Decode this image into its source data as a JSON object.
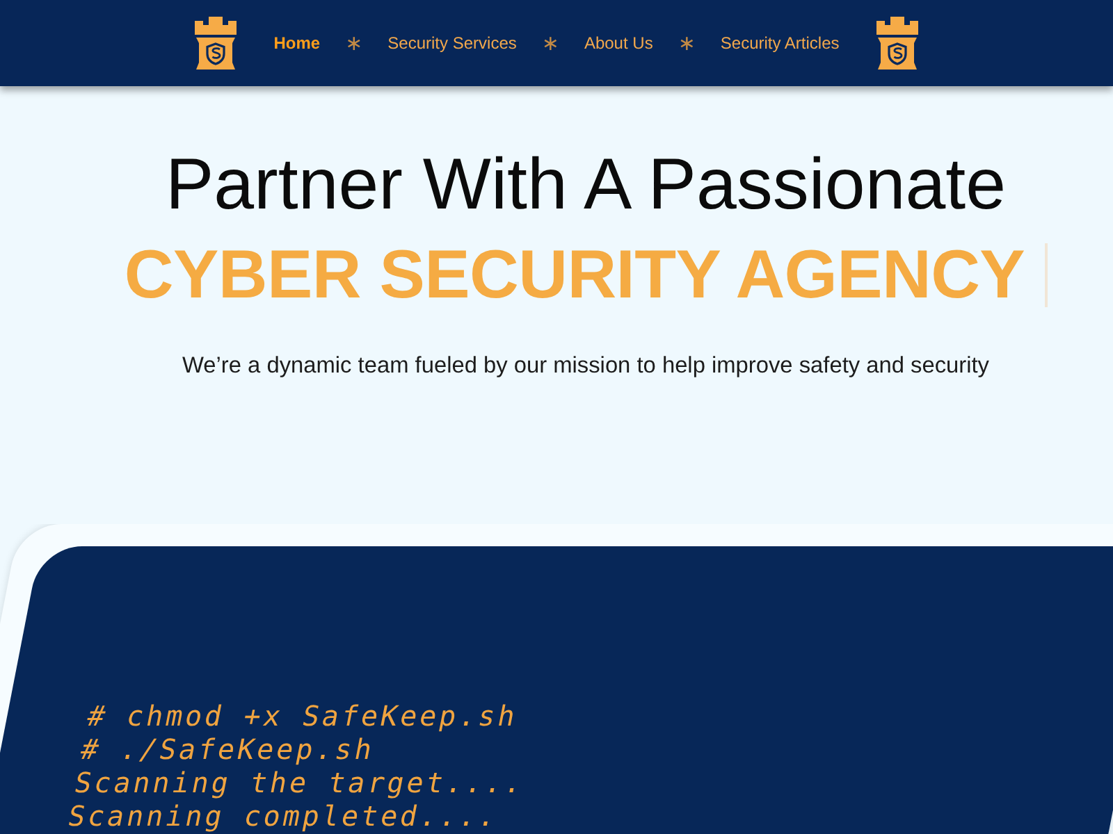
{
  "nav": {
    "links": [
      {
        "label": "Home",
        "selected": true
      },
      {
        "label": "Security Services",
        "selected": false
      },
      {
        "label": "About Us",
        "selected": false
      },
      {
        "label": "Security Articles",
        "selected": false
      }
    ],
    "separators": [
      "∗",
      "∗",
      "∗"
    ]
  },
  "hero": {
    "title": "Partner With A Passionate",
    "highlight": "CYBER SECURITY AGENCY",
    "cursor": true,
    "subtitle": "We’re a dynamic team fueled by our mission to help improve safety and security"
  },
  "terminal": {
    "lines": [
      "# chmod +x SafeKeep.sh",
      "# ./SafeKeep.sh",
      "Scanning the target....",
      "Scanning completed...."
    ]
  }
}
